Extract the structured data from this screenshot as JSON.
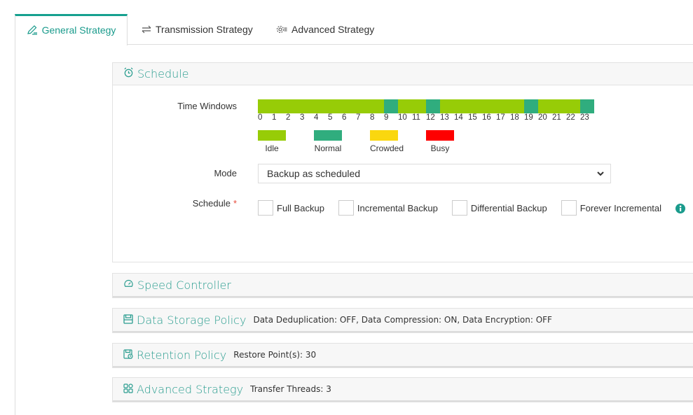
{
  "tabs": [
    {
      "label": "General Strategy",
      "icon": "edit-icon",
      "active": true
    },
    {
      "label": "Transmission Strategy",
      "icon": "transfer-icon",
      "active": false
    },
    {
      "label": "Advanced Strategy",
      "icon": "gear-list-icon",
      "active": false
    }
  ],
  "schedule": {
    "title": "Schedule",
    "time_windows_label": "Time Windows",
    "hours": [
      "0",
      "1",
      "2",
      "3",
      "4",
      "5",
      "6",
      "7",
      "8",
      "9",
      "10",
      "11",
      "12",
      "13",
      "14",
      "15",
      "16",
      "17",
      "18",
      "19",
      "20",
      "21",
      "22",
      "23"
    ],
    "hour_states": [
      "idle",
      "idle",
      "idle",
      "idle",
      "idle",
      "idle",
      "idle",
      "idle",
      "idle",
      "normal",
      "idle",
      "idle",
      "normal",
      "idle",
      "idle",
      "idle",
      "idle",
      "idle",
      "idle",
      "normal",
      "idle",
      "idle",
      "idle",
      "normal"
    ],
    "legend": [
      {
        "key": "idle",
        "label": "Idle",
        "color": "#97cc07"
      },
      {
        "key": "normal",
        "label": "Normal",
        "color": "#30ad7e"
      },
      {
        "key": "crowded",
        "label": "Crowded",
        "color": "#fad70f"
      },
      {
        "key": "busy",
        "label": "Busy",
        "color": "#fe0000"
      }
    ],
    "mode_label": "Mode",
    "mode_value": "Backup as scheduled",
    "schedule_label": "Schedule",
    "required_mark": "*",
    "options": [
      {
        "label": "Full Backup",
        "checked": false
      },
      {
        "label": "Incremental Backup",
        "checked": false
      },
      {
        "label": "Differential Backup",
        "checked": false
      },
      {
        "label": "Forever Incremental",
        "checked": false
      }
    ]
  },
  "sections": [
    {
      "title": "Speed Controller",
      "summary": "",
      "icon": "speedometer-icon"
    },
    {
      "title": "Data Storage Policy",
      "summary": "Data Deduplication: OFF, Data Compression: ON, Data Encryption: OFF",
      "icon": "save-icon"
    },
    {
      "title": "Retention Policy",
      "summary": "Restore Point(s): 30",
      "icon": "retention-icon"
    },
    {
      "title": "Advanced Strategy",
      "summary": "Transfer Threads: 3",
      "icon": "grid-icon"
    }
  ],
  "colors": {
    "accent": "#1a9b8c"
  }
}
